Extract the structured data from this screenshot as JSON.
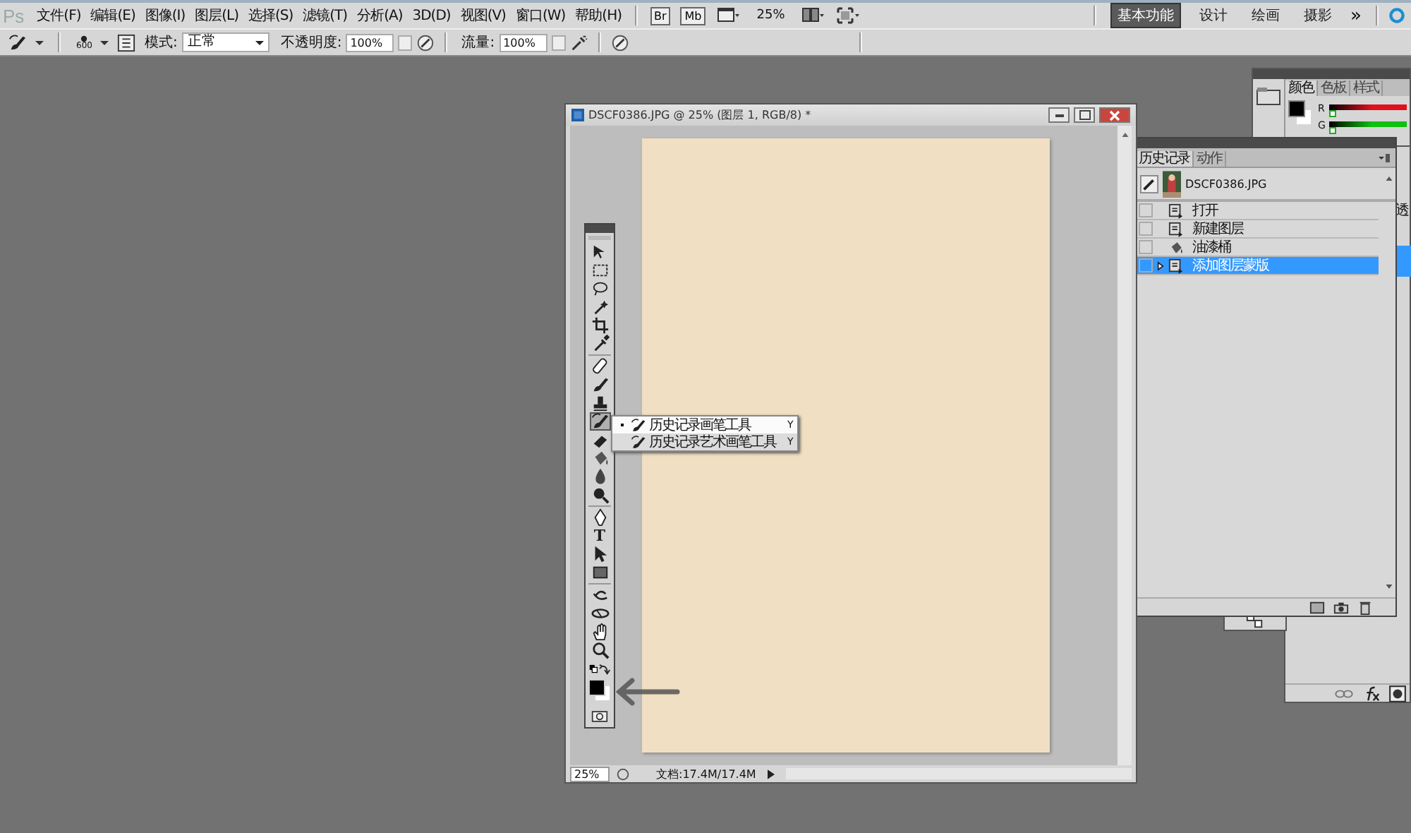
{
  "menubar": {
    "logo": "Ps",
    "menus": [
      "文件(F)",
      "编辑(E)",
      "图像(I)",
      "图层(L)",
      "选择(S)",
      "滤镜(T)",
      "分析(A)",
      "3D(D)",
      "视图(V)",
      "窗口(W)",
      "帮助(H)"
    ],
    "bridge": "Br",
    "mini_bridge": "Mb",
    "zoom": "25%",
    "workspaces": [
      {
        "label": "基本功能",
        "selected": true
      },
      {
        "label": "设计",
        "selected": false
      },
      {
        "label": "绘画",
        "selected": false
      },
      {
        "label": "摄影",
        "selected": false
      }
    ],
    "more": "»"
  },
  "options": {
    "brush_size": "600",
    "mode_label": "模式:",
    "mode": "正常",
    "opacity_label": "不透明度:",
    "opacity": "100%",
    "flow_label": "流量:",
    "flow": "100%"
  },
  "document": {
    "title": "DSCF0386.JPG @ 25% (图层 1, RGB/8) *",
    "zoom": "25%",
    "doc_info": "文档:17.4M/17.4M"
  },
  "toolbox": {
    "tools": [
      {
        "kind": "move",
        "selected": false
      },
      {
        "kind": "marquee",
        "selected": false
      },
      {
        "kind": "lasso",
        "selected": false
      },
      {
        "kind": "wand",
        "selected": false
      },
      {
        "kind": "crop",
        "selected": false
      },
      {
        "kind": "eyedropper",
        "selected": false
      },
      {
        "kind": "divider"
      },
      {
        "kind": "heal",
        "selected": false
      },
      {
        "kind": "brush",
        "selected": false
      },
      {
        "kind": "stamp",
        "selected": false
      },
      {
        "kind": "history",
        "selected": true
      },
      {
        "kind": "eraser",
        "selected": false
      },
      {
        "kind": "bucket",
        "selected": false
      },
      {
        "kind": "blur",
        "selected": false
      },
      {
        "kind": "dodge",
        "selected": false
      },
      {
        "kind": "divider"
      },
      {
        "kind": "pen",
        "selected": false
      },
      {
        "kind": "text",
        "label": "T",
        "selected": false
      },
      {
        "kind": "path",
        "selected": false
      },
      {
        "kind": "shape",
        "selected": false
      },
      {
        "kind": "divider"
      },
      {
        "kind": "rotate3d",
        "selected": false
      },
      {
        "kind": "orbit3d",
        "selected": false
      },
      {
        "kind": "hand",
        "selected": false
      },
      {
        "kind": "zoom",
        "selected": false
      }
    ]
  },
  "tool_flyout": [
    {
      "label": "历史记录画笔工具",
      "shortcut": "Y",
      "selected": true
    },
    {
      "label": "历史记录艺术画笔工具",
      "shortcut": "Y",
      "selected": false
    }
  ],
  "color_panel": {
    "tabs": [
      {
        "label": "颜色",
        "selected": true
      },
      {
        "label": "色板",
        "selected": false
      },
      {
        "label": "样式",
        "selected": false
      }
    ],
    "channels": [
      {
        "label": "R",
        "level": 0,
        "color": "#e0101c"
      },
      {
        "label": "G",
        "level": 0,
        "color": "#10c010"
      }
    ]
  },
  "history_panel": {
    "tabs": [
      {
        "label": "历史记录",
        "selected": true
      },
      {
        "label": "动作",
        "selected": false
      }
    ],
    "snapshot": "DSCF0386.JPG",
    "items": [
      {
        "label": "打开",
        "kind": "doc",
        "selected": false
      },
      {
        "label": "新建图层",
        "kind": "doc",
        "selected": false
      },
      {
        "label": "油漆桶",
        "kind": "bucket",
        "selected": false
      },
      {
        "label": "添加图层蒙版",
        "kind": "doc",
        "selected": true
      }
    ]
  },
  "layers_panel": {
    "label": "透"
  }
}
